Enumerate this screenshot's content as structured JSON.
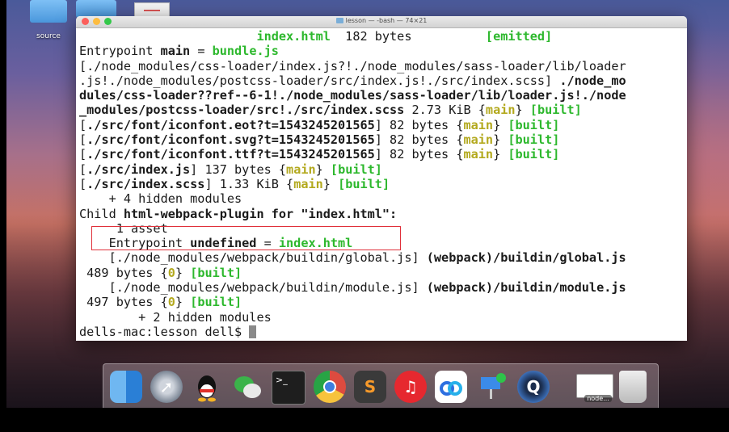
{
  "desktop": {
    "folder_label": "source"
  },
  "terminal": {
    "title": "lesson — -bash — 74×21",
    "lines": [
      [
        {
          "t": "                        "
        },
        {
          "t": "index.html",
          "c": "g"
        },
        {
          "t": "  182 bytes          "
        },
        {
          "t": "[emitted]",
          "c": "g"
        }
      ],
      [
        {
          "t": "Entrypoint "
        },
        {
          "t": "main",
          "c": "b"
        },
        {
          "t": " = "
        },
        {
          "t": "bundle.js",
          "c": "g"
        }
      ],
      [
        {
          "t": "[./node_modules/css-loader/index.js?!./node_modules/sass-loader/lib/loader"
        }
      ],
      [
        {
          "t": ".js!./node_modules/postcss-loader/src/index.js!./src/index.scss] "
        },
        {
          "t": "./node_mo",
          "c": "b"
        }
      ],
      [
        {
          "t": "dules/css-loader??ref--6-1!./node_modules/sass-loader/lib/loader.js!./node",
          "c": "b"
        }
      ],
      [
        {
          "t": "_modules/postcss-loader/src!./src/index.scss",
          "c": "b"
        },
        {
          "t": " 2.73 KiB {"
        },
        {
          "t": "main",
          "c": "y"
        },
        {
          "t": "} "
        },
        {
          "t": "[built]",
          "c": "g"
        }
      ],
      [
        {
          "t": "["
        },
        {
          "t": "./src/font/iconfont.eot?t=1543245201565",
          "c": "b"
        },
        {
          "t": "] 82 bytes {"
        },
        {
          "t": "main",
          "c": "y"
        },
        {
          "t": "} "
        },
        {
          "t": "[built]",
          "c": "g"
        }
      ],
      [
        {
          "t": "["
        },
        {
          "t": "./src/font/iconfont.svg?t=1543245201565",
          "c": "b"
        },
        {
          "t": "] 82 bytes {"
        },
        {
          "t": "main",
          "c": "y"
        },
        {
          "t": "} "
        },
        {
          "t": "[built]",
          "c": "g"
        }
      ],
      [
        {
          "t": "["
        },
        {
          "t": "./src/font/iconfont.ttf?t=1543245201565",
          "c": "b"
        },
        {
          "t": "] 82 bytes {"
        },
        {
          "t": "main",
          "c": "y"
        },
        {
          "t": "} "
        },
        {
          "t": "[built]",
          "c": "g"
        }
      ],
      [
        {
          "t": "["
        },
        {
          "t": "./src/index.js",
          "c": "b"
        },
        {
          "t": "] 137 bytes {"
        },
        {
          "t": "main",
          "c": "y"
        },
        {
          "t": "} "
        },
        {
          "t": "[built]",
          "c": "g"
        }
      ],
      [
        {
          "t": "["
        },
        {
          "t": "./src/index.scss",
          "c": "b"
        },
        {
          "t": "] 1.33 KiB {"
        },
        {
          "t": "main",
          "c": "y"
        },
        {
          "t": "} "
        },
        {
          "t": "[built]",
          "c": "g"
        }
      ],
      [
        {
          "t": "    + 4 hidden modules"
        }
      ],
      [
        {
          "t": "Child "
        },
        {
          "t": "html-webpack-plugin for \"index.html\":",
          "c": "b"
        }
      ],
      [
        {
          "t": "     1 asset"
        }
      ],
      [
        {
          "t": "    Entrypoint "
        },
        {
          "t": "undefined",
          "c": "b"
        },
        {
          "t": " = "
        },
        {
          "t": "index.html",
          "c": "g"
        }
      ],
      [
        {
          "t": "    [./node_modules/webpack/buildin/global.js] "
        },
        {
          "t": "(webpack)/buildin/global.js",
          "c": "b"
        }
      ],
      [
        {
          "t": " 489 bytes {"
        },
        {
          "t": "0",
          "c": "y"
        },
        {
          "t": "} "
        },
        {
          "t": "[built]",
          "c": "g"
        }
      ],
      [
        {
          "t": "    [./node_modules/webpack/buildin/module.js] "
        },
        {
          "t": "(webpack)/buildin/module.js",
          "c": "b"
        }
      ],
      [
        {
          "t": " 497 bytes {"
        },
        {
          "t": "0",
          "c": "y"
        },
        {
          "t": "} "
        },
        {
          "t": "[built]",
          "c": "g"
        }
      ],
      [
        {
          "t": "        + 2 hidden modules"
        }
      ],
      [
        {
          "t": "dells-mac:lesson dell$ "
        }
      ]
    ]
  },
  "dock": {
    "items": [
      "finder-icon",
      "launchpad-icon",
      "qq-icon",
      "wechat-icon",
      "terminal-icon",
      "chrome-icon",
      "sublime-text-icon",
      "netease-music-icon",
      "baidu-netdisk-icon",
      "keynote-icon",
      "quicktime-icon",
      "node-window-icon",
      "trash-icon"
    ],
    "node_label": "node..."
  },
  "colors": {
    "green": "#2db82d",
    "yellow": "#b3a91e",
    "highlight_box": "#e0303a"
  }
}
